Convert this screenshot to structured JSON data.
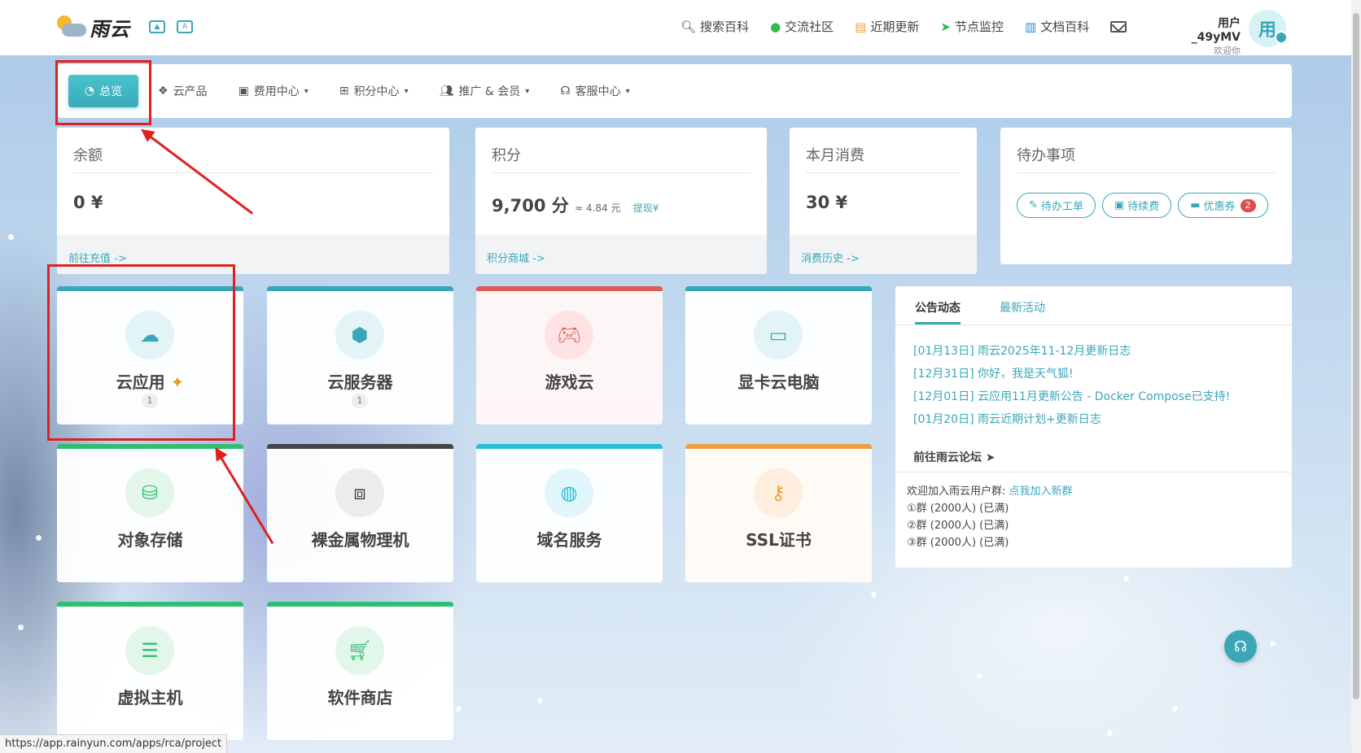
{
  "header": {
    "logo_text": "雨云",
    "topnav": [
      {
        "label": "搜索百科",
        "icon": "search-icon"
      },
      {
        "label": "交流社区",
        "icon": "wechat-icon"
      },
      {
        "label": "近期更新",
        "icon": "news-icon"
      },
      {
        "label": "节点监控",
        "icon": "send-icon"
      },
      {
        "label": "文档百科",
        "icon": "book-icon"
      }
    ],
    "user_name": "用户_49yMV",
    "user_sub": "欢迎你",
    "avatar_text": "用"
  },
  "mainnav": {
    "active_label": "总览",
    "items": [
      {
        "label": "云产品"
      },
      {
        "label": "费用中心"
      },
      {
        "label": "积分中心"
      },
      {
        "label": "推广 & 会员"
      },
      {
        "label": "客服中心"
      }
    ]
  },
  "stats": {
    "balance": {
      "title": "余额",
      "value": "0 ¥",
      "link": "前往充值 ->"
    },
    "points": {
      "title": "积分",
      "value": "9,700 分",
      "approx": "≈ 4.84 元",
      "withdraw": "提现¥",
      "link": "积分商城 ->"
    },
    "monthly": {
      "title": "本月消费",
      "value": "30 ¥",
      "link": "消费历史 ->"
    },
    "todo": {
      "title": "待办事项",
      "btn_ticket": "待办工单",
      "btn_renew": "待续费",
      "btn_coupon": "优惠券",
      "coupon_count": "2"
    }
  },
  "tiles": [
    {
      "label": "云应用",
      "count": "1",
      "icon": "cloud-icon",
      "accent": "#3aa7b8"
    },
    {
      "label": "云服务器",
      "count": "1",
      "icon": "cube-icon",
      "accent": "#3aa7b8"
    },
    {
      "label": "游戏云",
      "icon": "gamepad-icon",
      "accent": "#e05a5a"
    },
    {
      "label": "显卡云电脑",
      "icon": "monitor-icon",
      "accent": "#3aa7b8"
    },
    {
      "label": "对象存储",
      "icon": "database-icon",
      "accent": "#2fbf71"
    },
    {
      "label": "裸金属物理机",
      "icon": "vector-square-icon",
      "accent": "#444444"
    },
    {
      "label": "域名服务",
      "icon": "globe-icon",
      "accent": "#2bbdd6"
    },
    {
      "label": "SSL证书",
      "icon": "key-icon",
      "accent": "#f0a040"
    },
    {
      "label": "虚拟主机",
      "icon": "server-icon",
      "accent": "#2fbf71"
    },
    {
      "label": "软件商店",
      "icon": "cart-icon",
      "accent": "#2fbf71"
    }
  ],
  "announcements": {
    "tab_active": "公告动态",
    "tab_other": "最新活动",
    "items": [
      "[01月13日] 雨云2025年11-12月更新日志",
      "[12月31日] 你好，我是天气狐!",
      "[12月01日] 云应用11月更新公告 - Docker Compose已支持!",
      "[01月20日] 雨云近期计划+更新日志"
    ],
    "forum": "前往雨云论坛",
    "group_intro": "欢迎加入雨云用户群: ",
    "group_link": "点我加入新群",
    "groups": [
      "①群 (2000人) (已满)",
      "②群 (2000人) (已满)",
      "③群 (2000人) (已满)"
    ]
  },
  "statusbar": {
    "url": "https://app.rainyun.com/apps/rca/project"
  },
  "colors": {
    "accent": "#3aa7b8",
    "annotation_red": "#e02020"
  }
}
